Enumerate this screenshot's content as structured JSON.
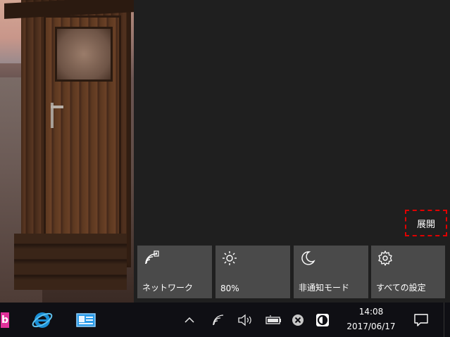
{
  "action_center": {
    "expand_label": "展開",
    "tiles": [
      {
        "label": "ネットワーク",
        "icon": "network-icon"
      },
      {
        "label": "80%",
        "icon": "brightness-icon"
      },
      {
        "label": "非通知モード",
        "icon": "quiet-hours-icon"
      },
      {
        "label": "すべての設定",
        "icon": "settings-gear-icon"
      }
    ]
  },
  "taskbar": {
    "apps": [
      {
        "name": "b-app",
        "glyph": "b",
        "color": "#e0309a"
      },
      {
        "name": "internet-explorer",
        "icon": "ie-icon"
      },
      {
        "name": "contact-card-app",
        "icon": "card-icon"
      }
    ],
    "tray": {
      "chevron": "^",
      "icons": [
        "network-icon",
        "volume-icon",
        "battery-icon",
        "close-circle-icon",
        "app-circle-icon"
      ]
    },
    "clock": {
      "time": "14:08",
      "date": "2017/06/17"
    },
    "notification_icon": "notification-icon"
  },
  "colors": {
    "panel_bg": "#1f1f1f",
    "tile_bg": "#4a4a4a",
    "taskbar_bg": "#0f0f14",
    "highlight_border": "#e00000"
  }
}
